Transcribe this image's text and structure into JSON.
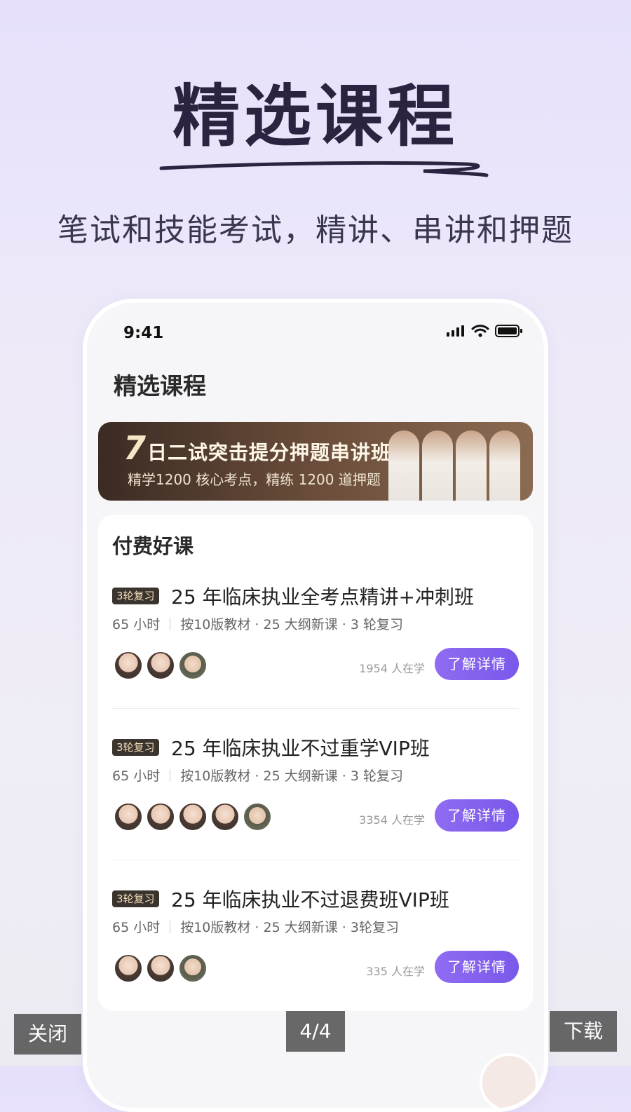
{
  "hero": {
    "title": "精选课程",
    "subtitle": "笔试和技能考试，精讲、串讲和押题"
  },
  "phone": {
    "status_time": "9:41",
    "status_icons": [
      "signal-icon",
      "wifi-icon",
      "battery-icon"
    ],
    "page_title": "精选课程",
    "banner": {
      "number": "7",
      "title": "日二试突击提分押题串讲班",
      "subtitle": "精学1200 核心考点，精练 1200 道押题"
    },
    "section_title": "付费好课",
    "courses": [
      {
        "badge": "3轮复习",
        "title": "25 年临床执业全考点精讲+冲刺班",
        "hours": "65 小时",
        "tags": "按10版教材 · 25 大纲新课 · 3 轮复习",
        "teacher_count": 3,
        "learners": "1954 人在学",
        "button": "了解详情"
      },
      {
        "badge": "3轮复习",
        "title": "25 年临床执业不过重学VIP班",
        "hours": "65 小时",
        "tags": "按10版教材 · 25 大纲新课 · 3 轮复习",
        "teacher_count": 5,
        "learners": "3354 人在学",
        "button": "了解详情"
      },
      {
        "badge": "3轮复习",
        "title": "25 年临床执业不过退费班VIP班",
        "hours": "65 小时",
        "tags": "按10版教材 · 25 大纲新课 · 3轮复习",
        "teacher_count": 3,
        "learners": "335 人在学",
        "button": "了解详情"
      }
    ]
  },
  "viewer": {
    "close_label": "关闭",
    "page_indicator": "4/4",
    "download_label": "下载"
  },
  "colors": {
    "accent": "#7a58ea",
    "title": "#2a2440",
    "badge_bg": "#3a342f",
    "banner_bg": "#4a362c"
  }
}
